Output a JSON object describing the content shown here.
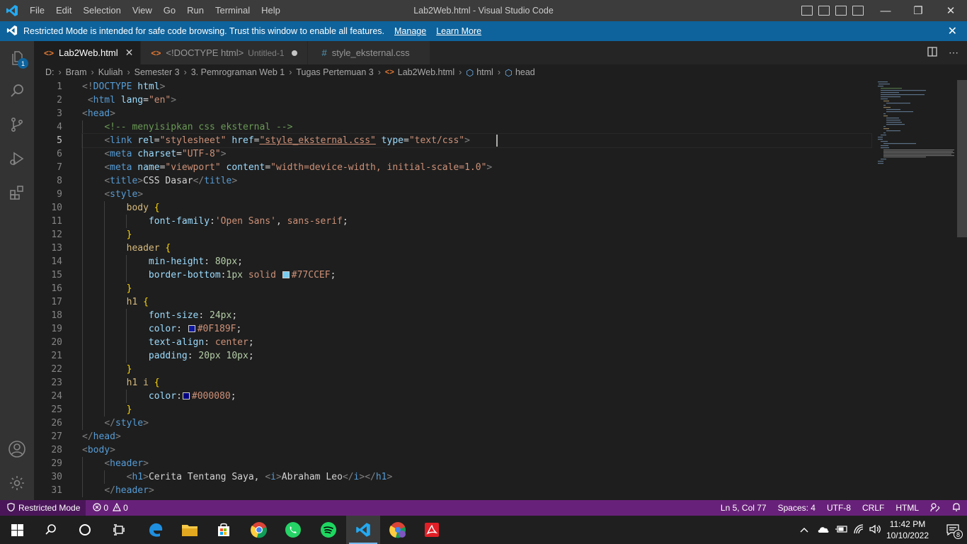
{
  "titlebar": {
    "menu": [
      "File",
      "Edit",
      "Selection",
      "View",
      "Go",
      "Run",
      "Terminal",
      "Help"
    ],
    "title": "Lab2Web.html - Visual Studio Code",
    "controls": {
      "minimize": "—",
      "restore": "❐",
      "close": "✕"
    }
  },
  "banner": {
    "text": "Restricted Mode is intended for safe code browsing. Trust this window to enable all features.",
    "manage": "Manage",
    "learn_more": "Learn More",
    "close": "✕",
    "color": "#0e639c"
  },
  "activity": {
    "items": [
      "explorer-icon",
      "search-icon",
      "source-control-icon",
      "run-debug-icon",
      "extensions-icon"
    ],
    "bottom": [
      "account-icon",
      "manage-gear-icon"
    ],
    "explorer_badge": "1"
  },
  "tabs": [
    {
      "icon": "<>",
      "label": "Lab2Web.html",
      "close": "✕"
    },
    {
      "icon": "<>",
      "label": "<!DOCTYPE html>",
      "sub": "Untitled-1"
    },
    {
      "icon": "#",
      "label": "style_eksternal.css"
    }
  ],
  "breadcrumb": {
    "parts": [
      "D:",
      "Bram",
      "Kuliah",
      "Semester 3",
      "3. Pemrograman Web 1",
      "Tugas Pertemuan 3"
    ],
    "file": "Lab2Web.html",
    "symbols": [
      "html",
      "head"
    ]
  },
  "editor": {
    "line_numbers": [
      "1",
      "2",
      "3",
      "4",
      "5",
      "6",
      "7",
      "8",
      "9",
      "10",
      "11",
      "12",
      "13",
      "14",
      "15",
      "16",
      "17",
      "18",
      "19",
      "20",
      "21",
      "22",
      "23",
      "24",
      "25",
      "26",
      "27",
      "28",
      "29",
      "30",
      "31"
    ],
    "current_line": 5,
    "code": {
      "l1a": "<!",
      "l1b": "DOCTYPE",
      "l1c": " html",
      "l1d": ">",
      "l2a": "<",
      "l2b": "html",
      "l2c": " lang",
      "l2d": "=",
      "l2e": "\"en\"",
      "l2f": ">",
      "l3a": "<",
      "l3b": "head",
      "l3c": ">",
      "l4": "<!-- menyisipkan css eksternal -->",
      "l5a": "<",
      "l5b": "link",
      "l5c": " rel",
      "l5d": "=",
      "l5e": "\"stylesheet\"",
      "l5f": " href",
      "l5g": "=",
      "l5h": "\"style_eksternal.css\"",
      "l5i": " type",
      "l5j": "=",
      "l5k": "\"text/css\"",
      "l5l": ">",
      "l6a": "<",
      "l6b": "meta",
      "l6c": " charset",
      "l6d": "=",
      "l6e": "\"UTF-8\"",
      "l6f": ">",
      "l7a": "<",
      "l7b": "meta",
      "l7c": " name",
      "l7d": "=",
      "l7e": "\"viewport\"",
      "l7f": " content",
      "l7g": "=",
      "l7h": "\"width=device-width, initial-scale=1.0\"",
      "l7i": ">",
      "l8a": "<",
      "l8b": "title",
      "l8c": ">",
      "l8d": "CSS Dasar",
      "l8e": "</",
      "l8f": "title",
      "l8g": ">",
      "l9a": "<",
      "l9b": "style",
      "l9c": ">",
      "l10a": "body",
      "l10b": " {",
      "l11a": "font-family",
      "l11b": ":",
      "l11c": "'Open Sans'",
      "l11d": ", ",
      "l11e": "sans-serif",
      "l11f": ";",
      "l12": "}",
      "l13a": "header",
      "l13b": " {",
      "l14a": "min-height",
      "l14b": ": ",
      "l14c": "80px",
      "l14d": ";",
      "l15a": "border-bottom",
      "l15b": ":",
      "l15c": "1px",
      "l15d": " ",
      "l15e": "solid",
      "l15f": " ",
      "l15g": "#77CCEF",
      "l15h": ";",
      "l16": "}",
      "l17a": "h1",
      "l17b": " {",
      "l18a": "font-size",
      "l18b": ": ",
      "l18c": "24px",
      "l18d": ";",
      "l19a": "color",
      "l19b": ": ",
      "l19c": "#0F189F",
      "l19d": ";",
      "l20a": "text-align",
      "l20b": ": ",
      "l20c": "center",
      "l20d": ";",
      "l21a": "padding",
      "l21b": ": ",
      "l21c": "20px 10px",
      "l21d": ";",
      "l22": "}",
      "l23a": "h1 i",
      "l23b": " {",
      "l24a": "color",
      "l24b": ":",
      "l24c": "#000080",
      "l24d": ";",
      "l25": "}",
      "l26a": "</",
      "l26b": "style",
      "l26c": ">",
      "l27a": "</",
      "l27b": "head",
      "l27c": ">",
      "l28a": "<",
      "l28b": "body",
      "l28c": ">",
      "l29a": "<",
      "l29b": "header",
      "l29c": ">",
      "l30a": "<",
      "l30b": "h1",
      "l30c": ">",
      "l30d": "Cerita Tentang Saya, ",
      "l30e": "<",
      "l30f": "i",
      "l30g": ">",
      "l30h": "Abraham Leo",
      "l30i": "</",
      "l30j": "i",
      "l30k": "></",
      "l30l": "h1",
      "l30m": ">",
      "l31a": "</",
      "l31b": "header",
      "l31c": ">"
    },
    "swatches": {
      "border": "#77CCEF",
      "h1": "#0F189F",
      "i": "#000080"
    }
  },
  "status": {
    "mode": "Restricted Mode",
    "errors": "0",
    "warnings": "0",
    "position": "Ln 5, Col 77",
    "spaces": "Spaces: 4",
    "encoding": "UTF-8",
    "eol": "CRLF",
    "language": "HTML",
    "color": "#68217a"
  },
  "taskbar": {
    "apps": [
      "windows-start-icon",
      "search-icon",
      "cortana-icon",
      "task-view-icon",
      "edge-icon",
      "file-explorer-icon",
      "store-icon",
      "chrome-icon",
      "whatsapp-icon",
      "spotify-icon",
      "vscode-icon",
      "chrome-profile-icon",
      "acrobat-icon"
    ],
    "time": "11:42 PM",
    "date": "10/10/2022",
    "notifications": "8"
  }
}
